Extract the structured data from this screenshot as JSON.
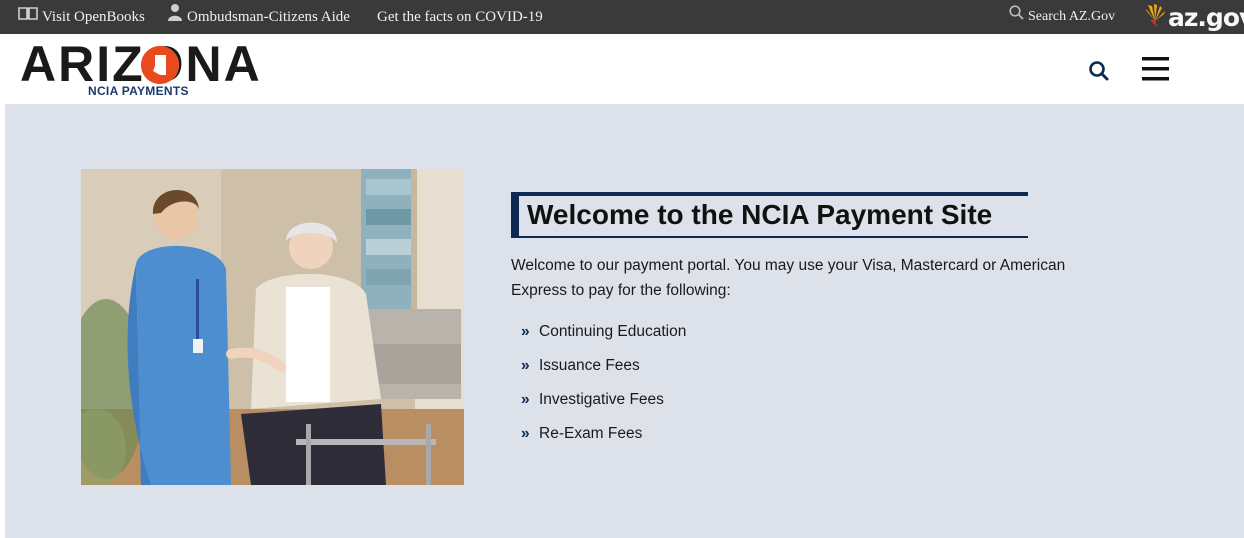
{
  "topbar": {
    "openbooks_label": "Visit OpenBooks",
    "ombudsman_label": "Ombudsman-Citizens Aide",
    "covid_label": "Get the facts on COVID-19",
    "search_label": "Search AZ.Gov",
    "azgov_logo_text": "az.gov"
  },
  "header": {
    "logo_text": "ARIZONA",
    "logo_subtitle": "NCIA PAYMENTS",
    "search_icon": "search-icon",
    "menu_icon": "hamburger-menu-icon"
  },
  "main": {
    "heading": "Welcome to the NCIA Payment Site",
    "intro": "Welcome to our payment portal. You may use your Visa, Mastercard or American Express to pay for the following:",
    "fees": [
      "Continuing Education",
      "Issuance Fees",
      "Investigative Fees",
      "Re-Exam Fees"
    ]
  },
  "colors": {
    "topbar_bg": "#3a3a3a",
    "main_bg": "#dde1e9",
    "accent_navy": "#0c2a53",
    "logo_orange": "#e8491d"
  }
}
